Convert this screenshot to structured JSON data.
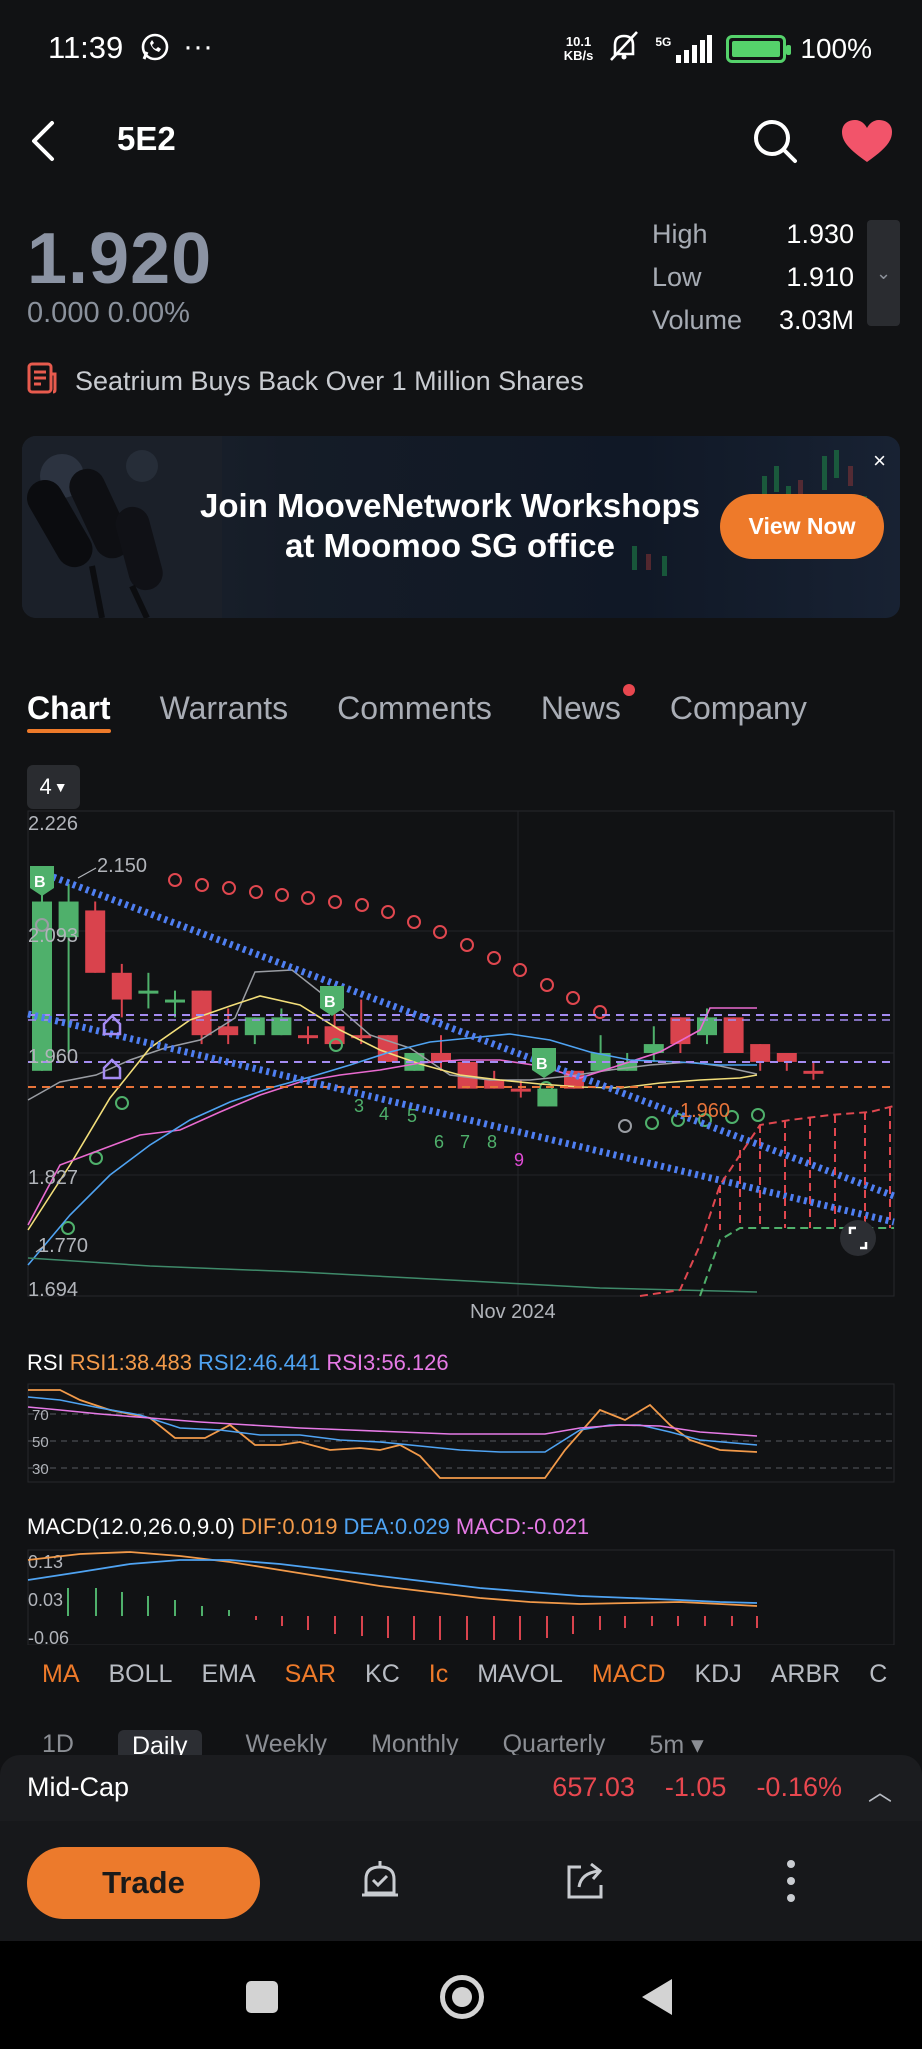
{
  "status_bar": {
    "time": "11:39",
    "net_speed_value": "10.1",
    "net_speed_unit": "KB/s",
    "network": "5G",
    "battery": "100%"
  },
  "header": {
    "ticker": "5E2",
    "back_icon": "back-arrow-icon",
    "search_icon": "search-icon",
    "favorite_icon": "heart-icon",
    "favorite_color": "#f2546a"
  },
  "quote": {
    "price": "1.920",
    "change": "0.000 0.00%",
    "stats": [
      {
        "label": "High",
        "value": "1.930"
      },
      {
        "label": "Low",
        "value": "1.910"
      },
      {
        "label": "Volume",
        "value": "3.03M"
      }
    ]
  },
  "news_headline": "Seatrium Buys Back Over 1 Million Shares",
  "banner": {
    "line1": "Join MooveNetwork Workshops",
    "line2": "at Moomoo SG office",
    "button": "View Now",
    "close": "×"
  },
  "tabs": [
    {
      "label": "Chart",
      "active": true
    },
    {
      "label": "Warrants"
    },
    {
      "label": "Comments"
    },
    {
      "label": "News",
      "badge": true
    },
    {
      "label": "Company"
    }
  ],
  "chart_period_selector": "4",
  "chart_data": [
    {
      "type": "candlestick",
      "y_ticks": [
        "2.226",
        "2.093",
        "1.960",
        "1.827",
        "1.694"
      ],
      "ylim": [
        1.694,
        2.226
      ],
      "x_label": "Nov 2024",
      "annotations": [
        "2.150",
        "1.770",
        "1.960",
        "B",
        "3",
        "4",
        "5",
        "6",
        "7",
        "8",
        "9"
      ],
      "candles": [
        {
          "o": 1.94,
          "c": 2.13,
          "h": 2.14,
          "l": 1.94,
          "color": "green"
        },
        {
          "o": 2.09,
          "c": 2.13,
          "h": 2.15,
          "l": 1.96,
          "color": "green"
        },
        {
          "o": 2.12,
          "c": 2.05,
          "h": 2.13,
          "l": 2.05,
          "color": "red"
        },
        {
          "o": 2.05,
          "c": 2.02,
          "h": 2.06,
          "l": 2.0,
          "color": "red"
        },
        {
          "o": 2.03,
          "c": 2.03,
          "h": 2.05,
          "l": 2.01,
          "color": "green"
        },
        {
          "o": 2.02,
          "c": 2.02,
          "h": 2.03,
          "l": 2.0,
          "color": "green"
        },
        {
          "o": 2.03,
          "c": 1.98,
          "h": 2.03,
          "l": 1.97,
          "color": "red"
        },
        {
          "o": 1.99,
          "c": 1.98,
          "h": 2.01,
          "l": 1.97,
          "color": "red"
        },
        {
          "o": 1.98,
          "c": 2.0,
          "h": 2.0,
          "l": 1.97,
          "color": "green"
        },
        {
          "o": 1.98,
          "c": 2.0,
          "h": 2.01,
          "l": 1.98,
          "color": "green"
        },
        {
          "o": 1.98,
          "c": 1.98,
          "h": 1.99,
          "l": 1.97,
          "color": "red"
        },
        {
          "o": 1.99,
          "c": 1.97,
          "h": 2.03,
          "l": 1.97,
          "color": "red"
        },
        {
          "o": 1.98,
          "c": 1.98,
          "h": 2.02,
          "l": 1.97,
          "color": "red"
        },
        {
          "o": 1.98,
          "c": 1.95,
          "h": 1.98,
          "l": 1.95,
          "color": "red"
        },
        {
          "o": 1.94,
          "c": 1.96,
          "h": 1.96,
          "l": 1.94,
          "color": "green"
        },
        {
          "o": 1.96,
          "c": 1.95,
          "h": 1.98,
          "l": 1.94,
          "color": "red"
        },
        {
          "o": 1.95,
          "c": 1.92,
          "h": 1.95,
          "l": 1.92,
          "color": "red"
        },
        {
          "o": 1.93,
          "c": 1.92,
          "h": 1.94,
          "l": 1.92,
          "color": "red"
        },
        {
          "o": 1.92,
          "c": 1.92,
          "h": 1.93,
          "l": 1.91,
          "color": "red"
        },
        {
          "o": 1.9,
          "c": 1.92,
          "h": 1.92,
          "l": 1.9,
          "color": "green"
        },
        {
          "o": 1.94,
          "c": 1.92,
          "h": 1.94,
          "l": 1.92,
          "color": "red"
        },
        {
          "o": 1.94,
          "c": 1.96,
          "h": 1.98,
          "l": 1.94,
          "color": "green"
        },
        {
          "o": 1.94,
          "c": 1.95,
          "h": 1.96,
          "l": 1.94,
          "color": "green"
        },
        {
          "o": 1.96,
          "c": 1.97,
          "h": 1.99,
          "l": 1.95,
          "color": "green"
        },
        {
          "o": 2.0,
          "c": 1.97,
          "h": 2.0,
          "l": 1.96,
          "color": "red"
        },
        {
          "o": 1.98,
          "c": 2.0,
          "h": 2.01,
          "l": 1.97,
          "color": "green"
        },
        {
          "o": 2.0,
          "c": 1.96,
          "h": 2.0,
          "l": 1.96,
          "color": "red"
        },
        {
          "o": 1.97,
          "c": 1.95,
          "h": 1.97,
          "l": 1.94,
          "color": "red"
        },
        {
          "o": 1.96,
          "c": 1.95,
          "h": 1.96,
          "l": 1.94,
          "color": "red"
        },
        {
          "o": 1.94,
          "c": 1.94,
          "h": 1.95,
          "l": 1.93,
          "color": "red"
        }
      ]
    },
    {
      "type": "line",
      "title": "RSI",
      "series": [
        {
          "name": "RSI1:38.483",
          "color": "#f29a4a"
        },
        {
          "name": "RSI2:46.441",
          "color": "#4fa3f2"
        },
        {
          "name": "RSI3:56.126",
          "color": "#e67ae6"
        }
      ],
      "y_ticks": [
        "70",
        "50",
        "30"
      ]
    },
    {
      "type": "line",
      "title": "MACD(12.0,26.0,9.0)",
      "series": [
        {
          "name": "DIF:0.019",
          "color": "#f29a4a"
        },
        {
          "name": "DEA:0.029",
          "color": "#4fa3f2"
        },
        {
          "name": "MACD:-0.021",
          "color": "#e67ae6"
        }
      ],
      "y_ticks": [
        "0.13",
        "0.03",
        "-0.06"
      ]
    }
  ],
  "indicators": [
    {
      "label": "MA",
      "on": true
    },
    {
      "label": "BOLL"
    },
    {
      "label": "EMA"
    },
    {
      "label": "SAR",
      "on": true
    },
    {
      "label": "KC"
    },
    {
      "label": "Ic",
      "on": true
    },
    {
      "label": "MAVOL"
    },
    {
      "label": "MACD",
      "on": true
    },
    {
      "label": "KDJ"
    },
    {
      "label": "ARBR"
    },
    {
      "label": "C"
    }
  ],
  "periods": [
    "1D",
    "Daily",
    "Weekly",
    "Monthly",
    "Quarterly",
    "5m ▾"
  ],
  "midcap": {
    "name": "Mid-Cap",
    "value": "657.03",
    "change": "-1.05",
    "pct": "-0.16%"
  },
  "bottom": {
    "trade": "Trade"
  },
  "colors": {
    "accent": "#ee7a2a",
    "up": "#4fb06b",
    "down": "#d9434d"
  }
}
